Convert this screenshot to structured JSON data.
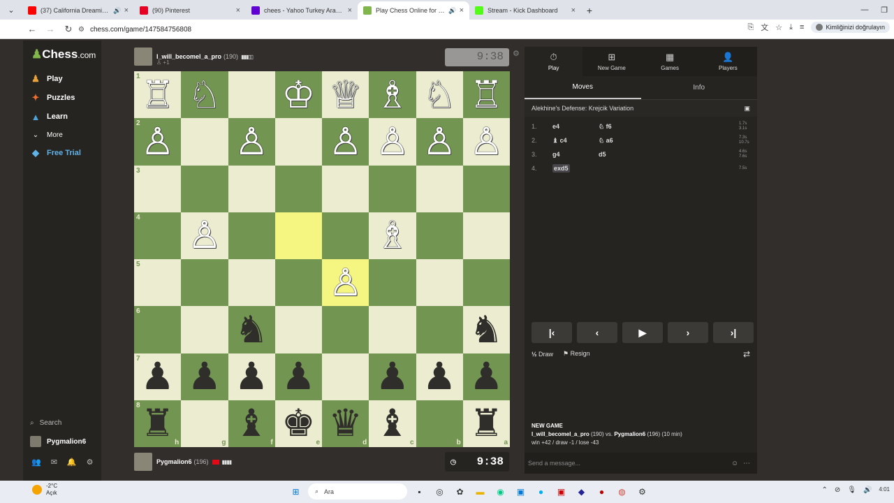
{
  "browser": {
    "tabs": [
      {
        "title": "(37) California Dreamin' - Yo",
        "icon_color": "#ff0000",
        "audio": true,
        "active": false
      },
      {
        "title": "(90) Pinterest",
        "icon_color": "#e60023",
        "audio": false,
        "active": false
      },
      {
        "title": "chees - Yahoo Turkey Arama So",
        "icon_color": "#6001d2",
        "audio": false,
        "active": false
      },
      {
        "title": "Play Chess Online for FREE",
        "icon_color": "#81b64c",
        "audio": true,
        "active": true
      },
      {
        "title": "Stream - Kick Dashboard",
        "icon_color": "#53fc18",
        "audio": false,
        "active": false
      }
    ],
    "url": "chess.com/game/147584756808",
    "profile_label": "Kimliğinizi doğrulayın"
  },
  "sidebar": {
    "logo": {
      "main": "Chess",
      "suffix": ".com"
    },
    "items": [
      {
        "label": "Play",
        "icon": "play-icon"
      },
      {
        "label": "Puzzles",
        "icon": "puzzle-icon"
      },
      {
        "label": "Learn",
        "icon": "learn-icon"
      },
      {
        "label": "More",
        "icon": "chevron-down-icon"
      },
      {
        "label": "Free Trial",
        "icon": "diamond-icon"
      }
    ],
    "search_label": "Search",
    "username": "Pygmalion6"
  },
  "game": {
    "top_player": {
      "name": "I_will_becomel_a_pro",
      "rating": "(190)",
      "extra": "+1",
      "clock": "9:38"
    },
    "bottom_player": {
      "name": "Pygmalion6",
      "rating": "(196)",
      "clock": "9:38"
    },
    "board": [
      [
        "wR",
        "wN",
        "",
        "wK",
        "wQ",
        "wB",
        "wN",
        "wR"
      ],
      [
        "wP",
        "",
        "wP",
        "",
        "wP",
        "wP",
        "wP",
        "wP"
      ],
      [
        "",
        "",
        "",
        "",
        "",
        "",
        "",
        ""
      ],
      [
        "",
        "wP",
        "",
        "",
        "",
        "wB",
        "",
        ""
      ],
      [
        "",
        "",
        "",
        "",
        "wP",
        "",
        "",
        ""
      ],
      [
        "",
        "",
        "bN",
        "",
        "",
        "",
        "",
        "bN"
      ],
      [
        "bP",
        "bP",
        "bP",
        "bP",
        "",
        "bP",
        "bP",
        "bP"
      ],
      [
        "bR",
        "",
        "bB",
        "bK",
        "bQ",
        "bB",
        "",
        "bR"
      ]
    ],
    "ranks": [
      "1",
      "2",
      "3",
      "4",
      "5",
      "6",
      "7",
      "8"
    ],
    "files": [
      "h",
      "g",
      "f",
      "e",
      "d",
      "c",
      "b",
      "a"
    ],
    "highlight": [
      [
        3,
        3
      ],
      [
        4,
        4
      ]
    ]
  },
  "panel": {
    "tabs": [
      {
        "label": "Play",
        "icon": "stopwatch-icon"
      },
      {
        "label": "New Game",
        "icon": "plus-icon"
      },
      {
        "label": "Games",
        "icon": "board-icon"
      },
      {
        "label": "Players",
        "icon": "players-icon"
      }
    ],
    "subtabs": [
      "Moves",
      "Info"
    ],
    "opening": "Alekhine's Defense: Krejcik Variation",
    "moves": [
      {
        "num": "1.",
        "white": "e4",
        "black": "f6",
        "black_piece": "♘",
        "white_piece": "",
        "times": [
          "1.7s",
          "3.1s"
        ]
      },
      {
        "num": "2.",
        "white": "c4",
        "black": "a6",
        "white_piece": "♝",
        "black_piece": "♘",
        "times": [
          "7.3s",
          "10.7s"
        ]
      },
      {
        "num": "3.",
        "white": "g4",
        "black": "d5",
        "white_piece": "",
        "black_piece": "",
        "times": [
          "4.6s",
          "7.6s"
        ]
      },
      {
        "num": "4.",
        "white": "exd5",
        "black": "",
        "white_piece": "",
        "black_piece": "",
        "times": [
          "7.5s"
        ]
      }
    ],
    "draw_label": "Draw",
    "draw_icon": "½",
    "resign_label": "Resign",
    "new_game": {
      "heading": "NEW GAME",
      "p1": "I_will_becomel_a_pro",
      "p1_rating": "(190)",
      "vs": "vs.",
      "p2": "Pygmalion6",
      "p2_rating": "(196)",
      "time": "(10 min)",
      "stats": "win +42 / draw -1 / lose -43"
    },
    "message_placeholder": "Send a message..."
  },
  "taskbar": {
    "temp": "-2°C",
    "condition": "Açık",
    "badge": "4",
    "search_label": "Ara",
    "clock": "4:01"
  }
}
